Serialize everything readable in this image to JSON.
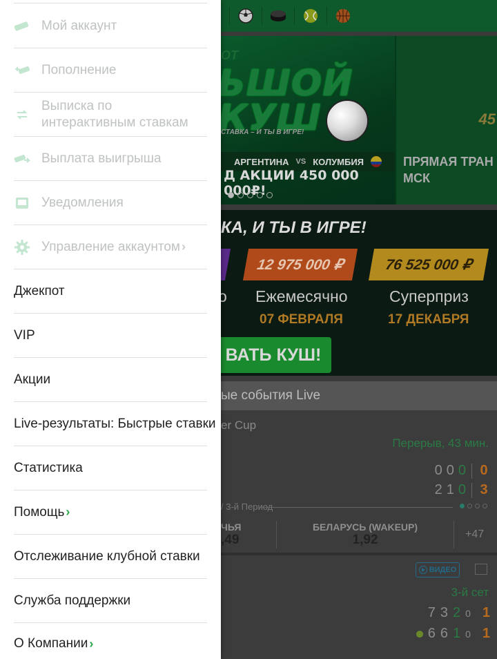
{
  "drawer": {
    "account_items": [
      {
        "label": "Мой аккаунт",
        "icon": "wallet-icon"
      },
      {
        "label": "Пополнение",
        "icon": "deposit-icon"
      },
      {
        "label": "Выписка по\nинтерактивным ставкам",
        "icon": "statement-icon"
      },
      {
        "label": "Выплата выигрыша",
        "icon": "withdraw-icon"
      },
      {
        "label": "Уведомления",
        "icon": "inbox-icon"
      },
      {
        "label": "Управление аккаунтом",
        "icon": "gear-icon",
        "chevron": true
      }
    ],
    "main_items": [
      {
        "label": "Джекпот"
      },
      {
        "label": "VIP"
      },
      {
        "label": "Акции"
      },
      {
        "label": "Live-результаты: Быстрые ставки"
      },
      {
        "label": "Статистика"
      },
      {
        "label": "Помощь",
        "chevron": true
      },
      {
        "label": "Отслеживание клубной ставки"
      },
      {
        "label": "Служба поддержки"
      },
      {
        "label": "О Компании",
        "chevron": true
      }
    ],
    "chevron_glyph": "›"
  },
  "background": {
    "sport_icons": [
      "soccer-ball-icon",
      "hockey-puck-icon",
      "tennis-ball-icon",
      "basketball-icon"
    ],
    "banner": {
      "title_fragment": "ЬШОЙ\nКУШ",
      "top_fragment": "ОТ",
      "tagline": "СТАВКА – И ТЫ В ИГРЕ!",
      "team1": "АРГЕНТИНА",
      "vs": "VS",
      "team2": "КОЛУМБИЯ",
      "promo": "Д АКЦИИ 450 000 000₽!",
      "side_title": "ПРЯМАЯ ТРАН\nМСК",
      "side_number": "45",
      "active_slide": 1,
      "slides_count": 5
    },
    "jackpot": {
      "title": "КА, И ТЫ В ИГРЕ!",
      "monthly_amount": "12 975 000 ₽",
      "super_amount": "76 525 000 ₽",
      "left_label_fragment": "о",
      "monthly_label": "Ежемесячно",
      "super_label": "Суперприз",
      "monthly_date": "07 ФЕВРАЛЯ",
      "super_date": "17 ДЕКАБРЯ",
      "button_label": "ВАТЬ КУШ!"
    },
    "live": {
      "header": "ые события Live",
      "league_fragment": "er Cup",
      "status": "Перерыв, 43 мин.",
      "score_rows": [
        {
          "a": "0",
          "b": "0",
          "c": "0",
          "total": "0"
        },
        {
          "a": "2",
          "b": "1",
          "c": "0",
          "total": "3"
        }
      ],
      "period": "/ 3-й Период",
      "odd1_name": "ЧЬЯ",
      "odd1_value": ",49",
      "odd2_name": "БЕЛАРУСЬ (WAKEUP)",
      "odd2_value": "1,92",
      "more": "+47",
      "video_label": "ВИДЕО",
      "set_label": "3-й сет",
      "tennis_rows": [
        {
          "s1": "7",
          "s2": "3",
          "s3": "2",
          "game": "0",
          "total": "1",
          "serving": false
        },
        {
          "s1": "6",
          "s2": "6",
          "s3": "1",
          "game": "0",
          "total": "1",
          "serving": true
        }
      ]
    }
  }
}
